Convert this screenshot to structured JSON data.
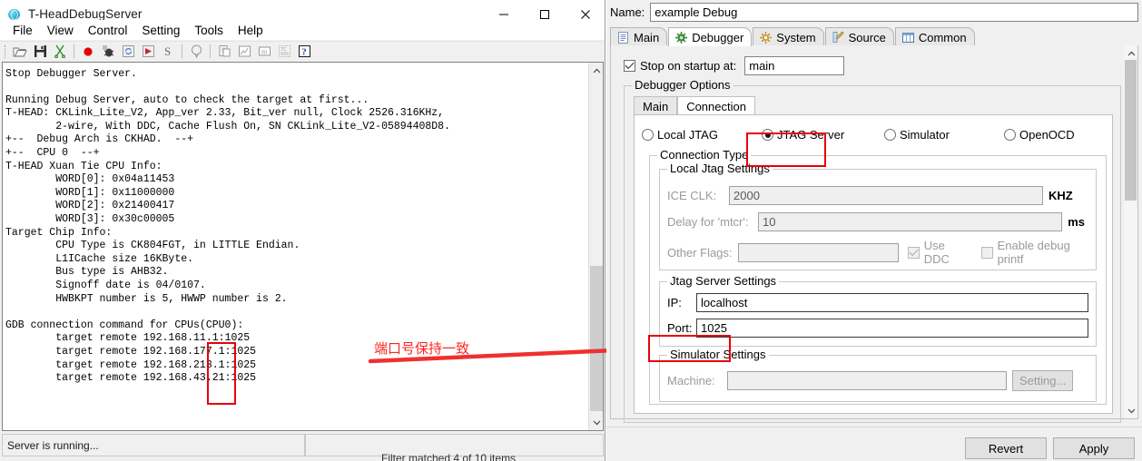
{
  "left_window": {
    "title": "T-HeadDebugServer",
    "app_icon": "globe-icon",
    "window_controls": {
      "minimize": "minimize-icon",
      "maximize": "maximize-icon",
      "close": "close-icon"
    },
    "menu": [
      {
        "label": "File"
      },
      {
        "label": "View"
      },
      {
        "label": "Control"
      },
      {
        "label": "Setting"
      },
      {
        "label": "Tools"
      },
      {
        "label": "Help"
      }
    ],
    "toolbar": [
      {
        "name": "open-folder-icon"
      },
      {
        "name": "save-icon"
      },
      {
        "name": "scissors-icon"
      },
      {
        "name": "record-icon"
      },
      {
        "name": "bug-icon"
      },
      {
        "name": "refresh-icon"
      },
      {
        "name": "run-icon"
      },
      {
        "name": "step-s-icon"
      },
      {
        "name": "balloon-icon"
      },
      {
        "name": "page-icon"
      },
      {
        "name": "chart-icon"
      },
      {
        "name": "memory-icon"
      },
      {
        "name": "register-icon"
      },
      {
        "name": "help-icon"
      }
    ],
    "console_text": "Stop Debugger Server.\n\nRunning Debug Server, auto to check the target at first...\nT-HEAD: CKLink_Lite_V2, App_ver 2.33, Bit_ver null, Clock 2526.316KHz,\n        2-wire, With DDC, Cache Flush On, SN CKLink_Lite_V2-05894408D8.\n+--  Debug Arch is CKHAD.  --+\n+--  CPU 0  --+\nT-HEAD Xuan Tie CPU Info:\n        WORD[0]: 0x04a11453\n        WORD[1]: 0x11000000\n        WORD[2]: 0x21400417\n        WORD[3]: 0x30c00005\nTarget Chip Info:\n        CPU Type is CK804FGT, in LITTLE Endian.\n        L1ICache size 16KByte.\n        Bus type is AHB32.\n        Signoff date is 04/0107.\n        HWBKPT number is 5, HWWP number is 2.\n\nGDB connection command for CPUs(CPU0):\n        target remote 192.168.11.1:1025\n        target remote 192.168.177.1:1025\n        target remote 192.168.213.1:1025\n        target remote 192.168.43.21:1025",
    "status_left": "Server is running...",
    "status_right": "",
    "filter_status": "Filter matched 4 of 10 items",
    "annotation": {
      "text": "端口号保持一致",
      "color": "#ff2424"
    },
    "scrollbar": {
      "up_arrow": "chevron-up-icon",
      "down_arrow": "chevron-down-icon"
    }
  },
  "right_panel": {
    "name_label": "Name:",
    "name_value": "example Debug",
    "tabs": [
      {
        "label": "Main",
        "icon": "document-icon",
        "active": false
      },
      {
        "label": "Debugger",
        "icon": "bug-gear-icon",
        "active": true
      },
      {
        "label": "System",
        "icon": "gear-icon",
        "active": false
      },
      {
        "label": "Source",
        "icon": "source-pencil-icon",
        "active": false
      },
      {
        "label": "Common",
        "icon": "table-icon",
        "active": false
      }
    ],
    "stop_on_startup": {
      "label": "Stop on startup at:",
      "checked": true,
      "value": "main"
    },
    "debugger_options": {
      "title": "Debugger Options",
      "inner_tabs": [
        {
          "label": "Main",
          "active": false
        },
        {
          "label": "Connection",
          "active": true
        }
      ],
      "connection_radios": [
        {
          "label": "Local JTAG",
          "selected": false
        },
        {
          "label": "JTAG Server",
          "selected": true
        },
        {
          "label": "Simulator",
          "selected": false
        },
        {
          "label": "OpenOCD",
          "selected": false
        }
      ],
      "connection_type": {
        "title": "Connection Type",
        "local_jtag_settings": {
          "title": "Local Jtag Settings",
          "ice_clk_label": "ICE CLK:",
          "ice_clk_value": "2000",
          "ice_clk_unit": "KHZ",
          "delay_label": "Delay for 'mtcr':",
          "delay_value": "10",
          "delay_unit": "ms",
          "other_flags_label": "Other Flags:",
          "other_flags_value": "",
          "use_ddc_label": "Use DDC",
          "use_ddc_checked": true,
          "enable_printf_label": "Enable debug printf",
          "enable_printf_checked": false
        },
        "jtag_server_settings": {
          "title": "Jtag Server Settings",
          "ip_label": "IP:",
          "ip_value": "localhost",
          "port_label": "Port:",
          "port_value": "1025"
        },
        "simulator_settings": {
          "title": "Simulator Settings",
          "machine_label": "Machine:",
          "machine_value": "",
          "setting_button": "Setting..."
        }
      }
    },
    "buttons": {
      "revert": "Revert",
      "apply": "Apply"
    }
  },
  "colors": {
    "annotation_red": "#e8000b",
    "window_bg": "#f0f0f0",
    "field_bg": "#ffffff"
  }
}
